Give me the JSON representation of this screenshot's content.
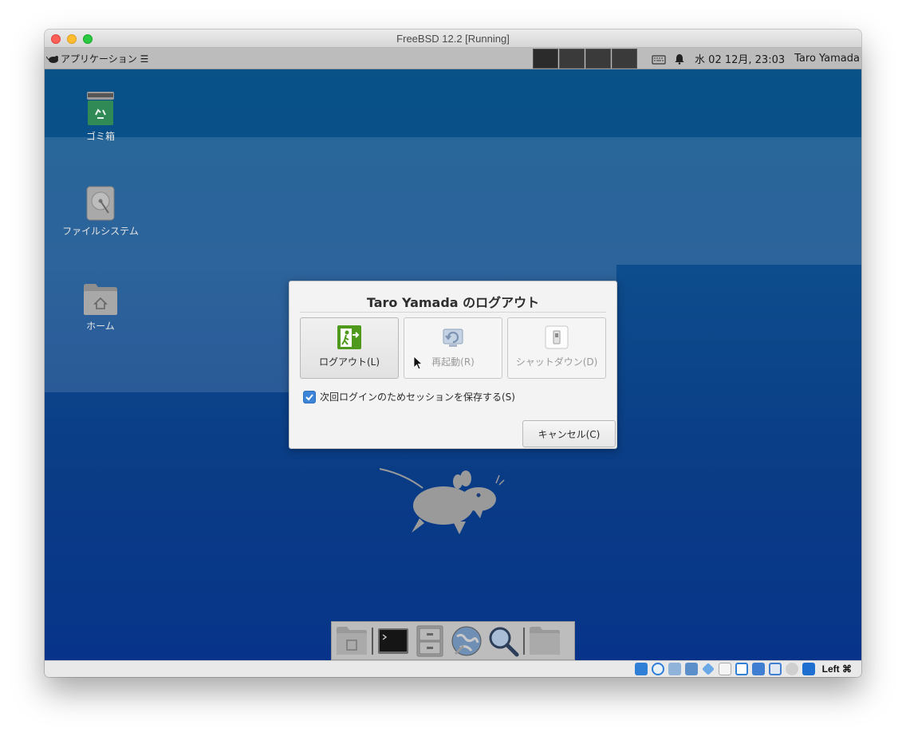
{
  "window": {
    "title": "FreeBSD 12.2 [Running]"
  },
  "panel": {
    "app_menu_label": "アプリケーション ☰",
    "clock": "水 02 12月, 23:03",
    "user": "Taro Yamada",
    "icons": [
      "keyboard-icon",
      "bell-icon"
    ]
  },
  "desktop_icons": [
    {
      "label": "ゴミ箱",
      "icon": "trash-icon"
    },
    {
      "label": "ファイルシステム",
      "icon": "hard-drive-icon"
    },
    {
      "label": "ホーム",
      "icon": "home-folder-icon"
    }
  ],
  "dialog": {
    "title": "Taro Yamada のログアウト",
    "actions": [
      {
        "label": "ログアウト(L)",
        "icon": "exit-icon",
        "enabled": true
      },
      {
        "label": "再起動(R)",
        "icon": "restart-icon",
        "enabled": false
      },
      {
        "label": "シャットダウン(D)",
        "icon": "power-switch-icon",
        "enabled": false
      }
    ],
    "save_session_label": "次回ログインのためセッションを保存する(S)",
    "save_session_checked": true,
    "cancel_label": "キャンセル(C)"
  },
  "dock": {
    "items": [
      "home-folder-icon",
      "terminal-icon",
      "file-manager-icon",
      "web-browser-icon",
      "search-icon",
      "folder-icon"
    ]
  },
  "statusbar": {
    "host_key": "Left ⌘"
  },
  "colors": {
    "desktop_blue": "#0d4d8d",
    "accent_blue": "#3b84d8",
    "logout_green": "#4f9a1c"
  }
}
